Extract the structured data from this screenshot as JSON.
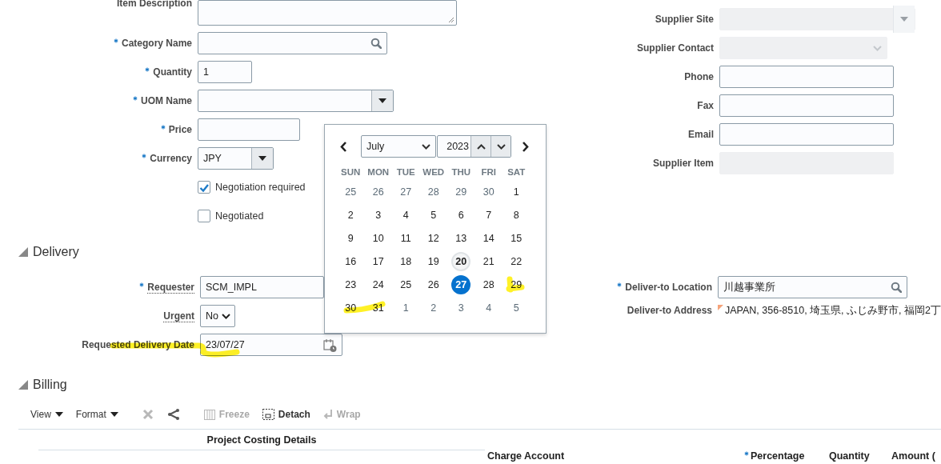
{
  "item_description": {
    "label": "Item Description"
  },
  "item_fields": [
    {
      "label": "Category Name",
      "required": true,
      "kind": "search"
    },
    {
      "label": "Quantity",
      "required": true,
      "kind": "text",
      "value": "1"
    },
    {
      "label": "UOM Name",
      "required": true,
      "kind": "select"
    },
    {
      "label": "Price",
      "required": true,
      "kind": "text"
    },
    {
      "label": "Currency",
      "required": true,
      "kind": "select",
      "value": "JPY"
    }
  ],
  "checkboxes": [
    {
      "label": "Negotiation required",
      "checked": true
    },
    {
      "label": "Negotiated",
      "checked": false
    }
  ],
  "supplier_fields": [
    {
      "label": "Supplier Site",
      "kind": "select",
      "disabled": true
    },
    {
      "label": "Supplier Contact",
      "kind": "choice",
      "disabled": true
    },
    {
      "label": "Phone",
      "kind": "text",
      "disabled": false
    },
    {
      "label": "Fax",
      "kind": "text",
      "disabled": false
    },
    {
      "label": "Email",
      "kind": "text",
      "disabled": false
    },
    {
      "label": "Supplier Item",
      "kind": "text",
      "disabled": true
    }
  ],
  "delivery": {
    "title": "Delivery",
    "expanded": true,
    "fields": [
      {
        "label": "Requester",
        "required": true,
        "kind": "text",
        "value": "SCM_IMPL"
      },
      {
        "label": "Urgent",
        "kind": "choice",
        "value": "No"
      },
      {
        "label": "Requested Delivery Date",
        "kind": "date",
        "value": "23/07/27"
      }
    ],
    "location_fields": [
      {
        "label": "Deliver-to Location",
        "required": true,
        "kind": "search",
        "value": "川越事業所"
      },
      {
        "label": "Deliver-to Address",
        "kind": "address",
        "value": "JAPAN, 356-8510, 埼玉県, ふじみ野市, 福岡2丁"
      }
    ]
  },
  "calendar": {
    "month": "July",
    "year": "2023",
    "weekdays": [
      "SUN",
      "MON",
      "TUE",
      "WED",
      "THU",
      "FRI",
      "SAT"
    ],
    "weeks": [
      [
        {
          "day": "25",
          "other_month": true,
          "today": false,
          "selected": false
        },
        {
          "day": "26",
          "other_month": true,
          "today": false,
          "selected": false
        },
        {
          "day": "27",
          "other_month": true,
          "today": false,
          "selected": false
        },
        {
          "day": "28",
          "other_month": true,
          "today": false,
          "selected": false
        },
        {
          "day": "29",
          "other_month": true,
          "today": false,
          "selected": false
        },
        {
          "day": "30",
          "other_month": true,
          "today": false,
          "selected": false
        },
        {
          "day": "1",
          "other_month": false,
          "today": false,
          "selected": false
        }
      ],
      [
        {
          "day": "2",
          "other_month": false,
          "today": false,
          "selected": false
        },
        {
          "day": "3",
          "other_month": false,
          "today": false,
          "selected": false
        },
        {
          "day": "4",
          "other_month": false,
          "today": false,
          "selected": false
        },
        {
          "day": "5",
          "other_month": false,
          "today": false,
          "selected": false
        },
        {
          "day": "6",
          "other_month": false,
          "today": false,
          "selected": false
        },
        {
          "day": "7",
          "other_month": false,
          "today": false,
          "selected": false
        },
        {
          "day": "8",
          "other_month": false,
          "today": false,
          "selected": false
        }
      ],
      [
        {
          "day": "9",
          "other_month": false,
          "today": false,
          "selected": false
        },
        {
          "day": "10",
          "other_month": false,
          "today": false,
          "selected": false
        },
        {
          "day": "11",
          "other_month": false,
          "today": false,
          "selected": false
        },
        {
          "day": "12",
          "other_month": false,
          "today": false,
          "selected": false
        },
        {
          "day": "13",
          "other_month": false,
          "today": false,
          "selected": false
        },
        {
          "day": "14",
          "other_month": false,
          "today": false,
          "selected": false
        },
        {
          "day": "15",
          "other_month": false,
          "today": false,
          "selected": false
        }
      ],
      [
        {
          "day": "16",
          "other_month": false,
          "today": false,
          "selected": false
        },
        {
          "day": "17",
          "other_month": false,
          "today": false,
          "selected": false
        },
        {
          "day": "18",
          "other_month": false,
          "today": false,
          "selected": false
        },
        {
          "day": "19",
          "other_month": false,
          "today": false,
          "selected": false
        },
        {
          "day": "20",
          "other_month": false,
          "today": true,
          "selected": false
        },
        {
          "day": "21",
          "other_month": false,
          "today": false,
          "selected": false
        },
        {
          "day": "22",
          "other_month": false,
          "today": false,
          "selected": false
        }
      ],
      [
        {
          "day": "23",
          "other_month": false,
          "today": false,
          "selected": false
        },
        {
          "day": "24",
          "other_month": false,
          "today": false,
          "selected": false
        },
        {
          "day": "25",
          "other_month": false,
          "today": false,
          "selected": false
        },
        {
          "day": "26",
          "other_month": false,
          "today": false,
          "selected": false
        },
        {
          "day": "27",
          "other_month": false,
          "today": false,
          "selected": true
        },
        {
          "day": "28",
          "other_month": false,
          "today": false,
          "selected": false
        },
        {
          "day": "29",
          "other_month": false,
          "today": false,
          "selected": false
        }
      ],
      [
        {
          "day": "30",
          "other_month": false,
          "today": false,
          "selected": false
        },
        {
          "day": "31",
          "other_month": false,
          "today": false,
          "selected": false
        },
        {
          "day": "1",
          "other_month": true,
          "today": false,
          "selected": false
        },
        {
          "day": "2",
          "other_month": true,
          "today": false,
          "selected": false
        },
        {
          "day": "3",
          "other_month": true,
          "today": false,
          "selected": false
        },
        {
          "day": "4",
          "other_month": true,
          "today": false,
          "selected": false
        },
        {
          "day": "5",
          "other_month": true,
          "today": false,
          "selected": false
        }
      ]
    ]
  },
  "billing": {
    "title": "Billing",
    "expanded": true,
    "toolbar": [
      {
        "kind": "menu",
        "label": "View",
        "disabled": false
      },
      {
        "kind": "menu",
        "label": "Format",
        "disabled": false
      },
      {
        "kind": "delete",
        "disabled": true
      },
      {
        "kind": "share",
        "disabled": false
      },
      {
        "kind": "freeze",
        "label": "Freeze",
        "disabled": true
      },
      {
        "kind": "detach",
        "label": "Detach",
        "disabled": false
      },
      {
        "kind": "wrap",
        "label": "Wrap",
        "disabled": true
      }
    ],
    "table": {
      "group_header": "Project Costing Details",
      "columns": [
        {
          "label": "Charge Account",
          "required": false
        },
        {
          "label": "Percentage",
          "required": true
        },
        {
          "label": "Quantity",
          "required": false
        },
        {
          "label": "Amount (",
          "required": false
        }
      ]
    }
  }
}
